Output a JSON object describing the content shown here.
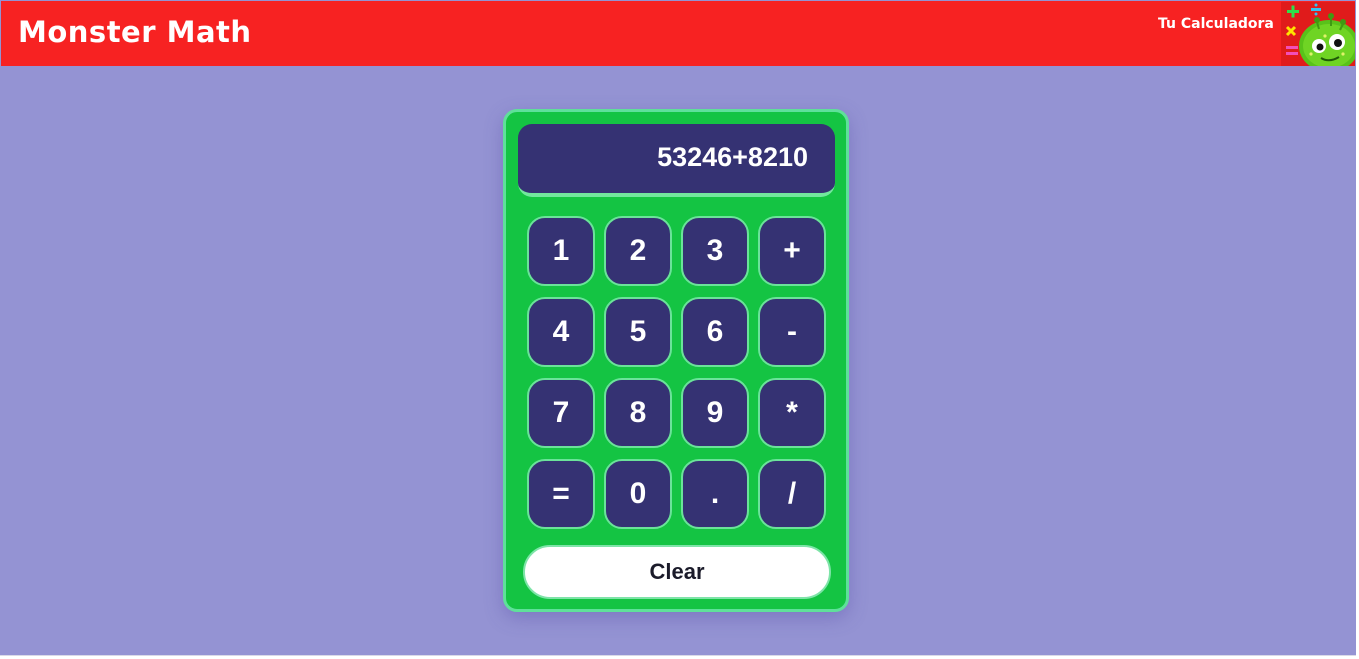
{
  "header": {
    "brand": "Monster Math",
    "tagline": "Tu Calculadora",
    "logo_icon": "monster-math-logo"
  },
  "calculator": {
    "display_value": "53246+8210",
    "keys": [
      "1",
      "2",
      "3",
      "+",
      "4",
      "5",
      "6",
      "-",
      "7",
      "8",
      "9",
      "*",
      "=",
      "0",
      ".",
      "/"
    ],
    "clear_label": "Clear"
  },
  "colors": {
    "page_background": "#9493d3",
    "header_background": "#f72222",
    "calculator_body": "#14c443",
    "key_background": "#353273",
    "key_border": "#6be39a"
  }
}
